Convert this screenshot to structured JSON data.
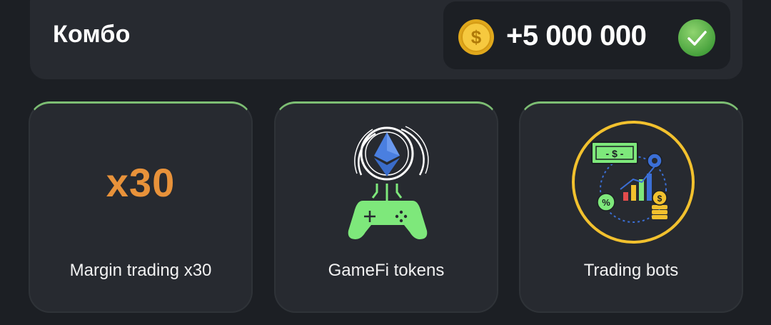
{
  "combo": {
    "title": "Комбо",
    "reward": "+5 000 000",
    "coin_icon": "dollar-coin-icon",
    "status_icon": "checkmark-icon",
    "accent_color": "#7dbe73"
  },
  "cards": [
    {
      "badge_text": "x30",
      "label": "Margin trading x30",
      "badge_color": "#e8923a"
    },
    {
      "icon": "ethereum-gamepad-icon",
      "label": "GameFi tokens"
    },
    {
      "icon": "trading-bots-icon",
      "label": "Trading bots"
    }
  ]
}
